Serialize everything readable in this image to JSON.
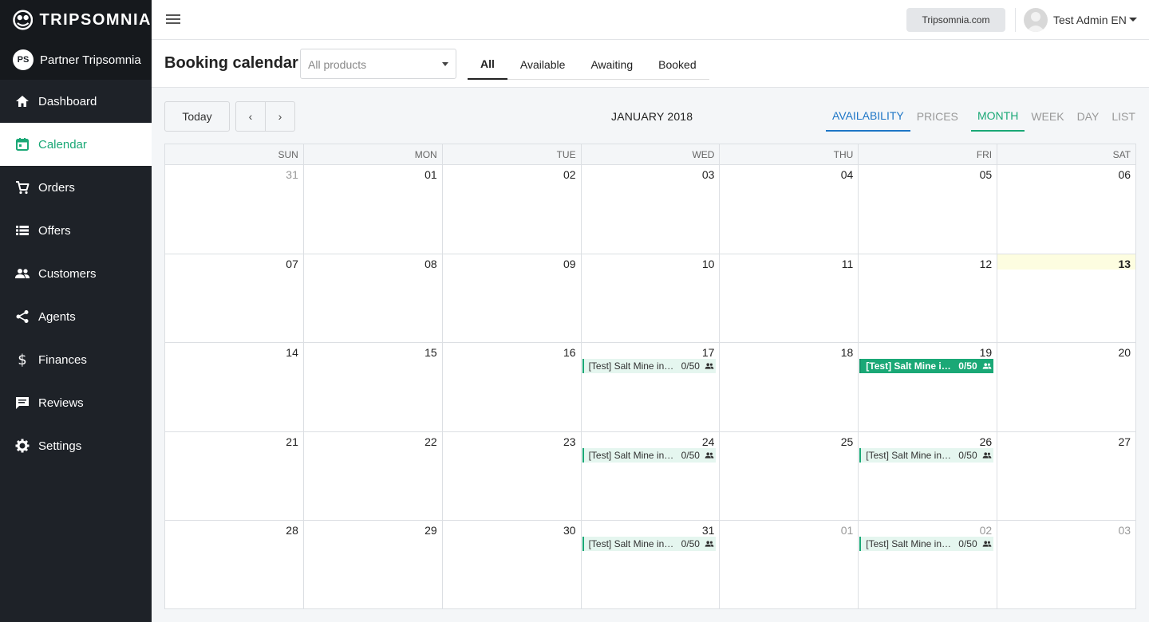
{
  "brand": {
    "name": "TRIPSOMNIA"
  },
  "partner": {
    "initials": "PS",
    "name": "Partner Tripsomnia"
  },
  "nav": [
    {
      "id": "dashboard",
      "label": "Dashboard",
      "icon": "home-icon",
      "active": false
    },
    {
      "id": "calendar",
      "label": "Calendar",
      "icon": "calendar-icon",
      "active": true
    },
    {
      "id": "orders",
      "label": "Orders",
      "icon": "cart-icon",
      "active": false
    },
    {
      "id": "offers",
      "label": "Offers",
      "icon": "list-icon",
      "active": false
    },
    {
      "id": "customers",
      "label": "Customers",
      "icon": "people-icon",
      "active": false
    },
    {
      "id": "agents",
      "label": "Agents",
      "icon": "share-icon",
      "active": false
    },
    {
      "id": "finances",
      "label": "Finances",
      "icon": "dollar-icon",
      "active": false
    },
    {
      "id": "reviews",
      "label": "Reviews",
      "icon": "chat-icon",
      "active": false
    },
    {
      "id": "settings",
      "label": "Settings",
      "icon": "gear-icon",
      "active": false
    }
  ],
  "topbar": {
    "site_button": "Tripsomnia.com",
    "user_name": "Test Admin EN"
  },
  "subheader": {
    "title": "Booking calendar",
    "product_placeholder": "All products",
    "filter_tabs": [
      "All",
      "Available",
      "Awaiting",
      "Booked"
    ],
    "active_filter": "All"
  },
  "toolbar": {
    "today": "Today",
    "prev": "‹",
    "next": "›",
    "month_title": "JANUARY 2018",
    "mode_tabs": [
      "AVAILABILITY",
      "PRICES"
    ],
    "active_mode": "AVAILABILITY",
    "view_tabs": [
      "MONTH",
      "WEEK",
      "DAY",
      "LIST"
    ],
    "active_view": "MONTH"
  },
  "calendar": {
    "weekdays": [
      "SUN",
      "MON",
      "TUE",
      "WED",
      "THU",
      "FRI",
      "SAT"
    ],
    "today": "13",
    "weeks": [
      [
        {
          "d": "31",
          "other": true
        },
        {
          "d": "01"
        },
        {
          "d": "02"
        },
        {
          "d": "03"
        },
        {
          "d": "04"
        },
        {
          "d": "05"
        },
        {
          "d": "06"
        }
      ],
      [
        {
          "d": "07"
        },
        {
          "d": "08"
        },
        {
          "d": "09"
        },
        {
          "d": "10"
        },
        {
          "d": "11"
        },
        {
          "d": "12"
        },
        {
          "d": "13",
          "today": true
        }
      ],
      [
        {
          "d": "14"
        },
        {
          "d": "15"
        },
        {
          "d": "16"
        },
        {
          "d": "17",
          "event": {
            "title": "[Test] Salt Mine in Wieliczka",
            "count": "0/50",
            "filled": false
          }
        },
        {
          "d": "18"
        },
        {
          "d": "19",
          "event": {
            "title": "[Test] Salt Mine in Wieliczka",
            "count": "0/50",
            "filled": true
          }
        },
        {
          "d": "20"
        }
      ],
      [
        {
          "d": "21"
        },
        {
          "d": "22"
        },
        {
          "d": "23"
        },
        {
          "d": "24",
          "event": {
            "title": "[Test] Salt Mine in Wieliczka",
            "count": "0/50",
            "filled": false
          }
        },
        {
          "d": "25"
        },
        {
          "d": "26",
          "event": {
            "title": "[Test] Salt Mine in Wieliczka",
            "count": "0/50",
            "filled": false
          }
        },
        {
          "d": "27"
        }
      ],
      [
        {
          "d": "28"
        },
        {
          "d": "29"
        },
        {
          "d": "30"
        },
        {
          "d": "31",
          "event": {
            "title": "[Test] Salt Mine in Wieliczka",
            "count": "0/50",
            "filled": false
          }
        },
        {
          "d": "01",
          "other": true
        },
        {
          "d": "02",
          "other": true,
          "event": {
            "title": "[Test] Salt Mine in Wieliczka",
            "count": "0/50",
            "filled": false
          }
        },
        {
          "d": "03",
          "other": true
        }
      ]
    ]
  },
  "colors": {
    "accent": "#1aa876",
    "blue": "#1e76c6",
    "sidebar": "#1e2228"
  }
}
